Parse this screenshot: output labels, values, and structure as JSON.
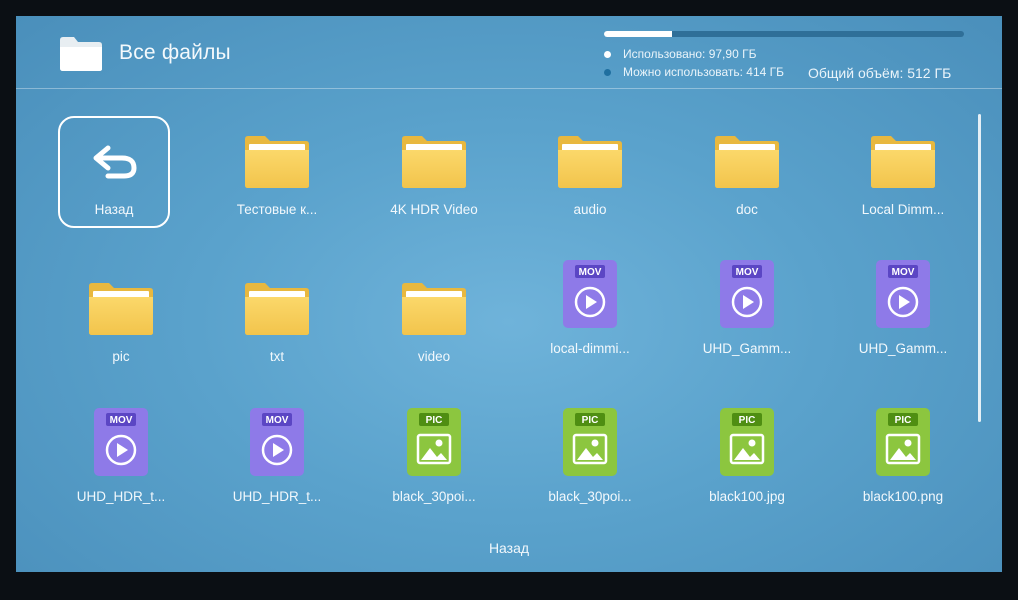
{
  "header": {
    "title": "Все файлы",
    "icon": "folder-icon",
    "storage": {
      "used_label": "Использовано: 97,90 ГБ",
      "available_label": "Можно использовать: 414 ГБ",
      "total_label": "Общий объём: 512 ГБ",
      "used_fraction": 0.19,
      "used_color": "#ffffff",
      "available_color": "#1f6fa0"
    }
  },
  "items": [
    {
      "type": "back",
      "label": "Назад",
      "icon": "back-arrow-icon"
    },
    {
      "type": "folder",
      "label": "Тестовые к...",
      "icon": "folder-icon"
    },
    {
      "type": "folder",
      "label": "4K HDR Video",
      "icon": "folder-icon"
    },
    {
      "type": "folder",
      "label": "audio",
      "icon": "folder-icon"
    },
    {
      "type": "folder",
      "label": "doc",
      "icon": "folder-icon"
    },
    {
      "type": "folder",
      "label": "Local Dimm...",
      "icon": "folder-icon"
    },
    {
      "type": "folder",
      "label": "pic",
      "icon": "folder-icon"
    },
    {
      "type": "folder",
      "label": "txt",
      "icon": "folder-icon"
    },
    {
      "type": "folder",
      "label": "video",
      "icon": "folder-icon"
    },
    {
      "type": "video",
      "badge": "MOV",
      "label": "local-dimmi...",
      "icon": "video-file-icon"
    },
    {
      "type": "video",
      "badge": "MOV",
      "label": "UHD_Gamm...",
      "icon": "video-file-icon"
    },
    {
      "type": "video",
      "badge": "MOV",
      "label": "UHD_Gamm...",
      "icon": "video-file-icon"
    },
    {
      "type": "video",
      "badge": "MOV",
      "label": "UHD_HDR_t...",
      "icon": "video-file-icon"
    },
    {
      "type": "video",
      "badge": "MOV",
      "label": "UHD_HDR_t...",
      "icon": "video-file-icon"
    },
    {
      "type": "image",
      "badge": "PIC",
      "label": "black_30poi...",
      "icon": "image-file-icon"
    },
    {
      "type": "image",
      "badge": "PIC",
      "label": "black_30poi...",
      "icon": "image-file-icon"
    },
    {
      "type": "image",
      "badge": "PIC",
      "label": "black100.jpg",
      "icon": "image-file-icon"
    },
    {
      "type": "image",
      "badge": "PIC",
      "label": "black100.png",
      "icon": "image-file-icon"
    }
  ],
  "footer": {
    "hint": "Назад"
  },
  "colors": {
    "folder": "#f6cf5a",
    "video": "#8e7ae8",
    "image": "#8cc63f"
  }
}
